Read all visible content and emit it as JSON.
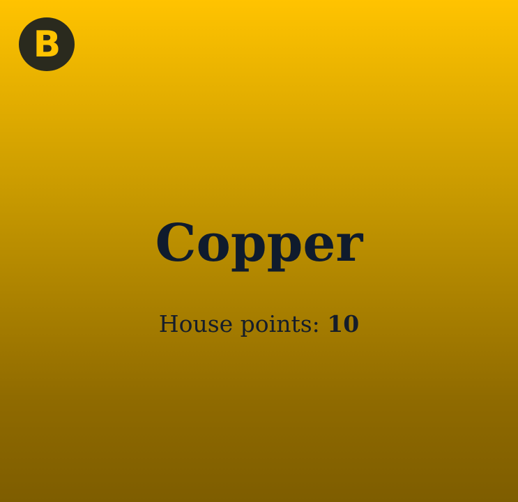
{
  "logo": {
    "letter": "B",
    "icon": "badge-b-icon",
    "background_color": "#2A2A1E",
    "letter_color": "#FFC300"
  },
  "house": {
    "name": "Copper",
    "points_label": "House points: ",
    "points_value": "10"
  },
  "colors": {
    "background_top": "#FFC300",
    "background_bottom": "#7E5D00",
    "text": "#0F1B2D"
  }
}
